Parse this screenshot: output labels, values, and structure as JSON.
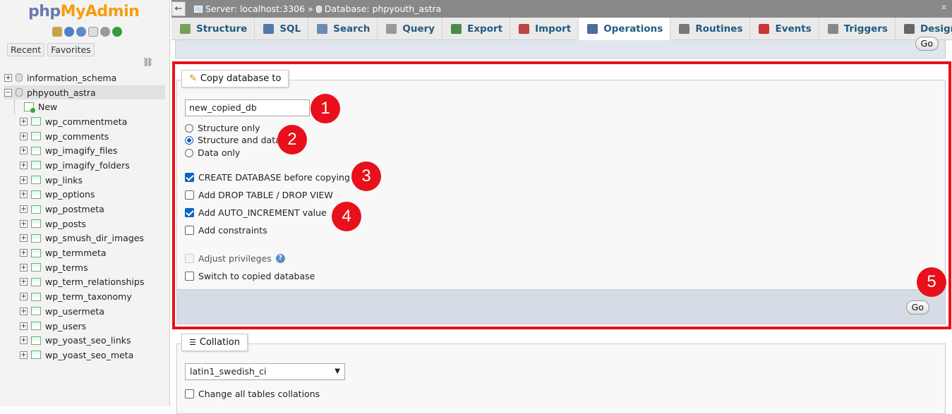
{
  "sidebar": {
    "logo_php": "php",
    "logo_myadmin": "MyAdmin",
    "tabs": [
      "Recent",
      "Favorites"
    ],
    "databases": [
      {
        "name": "information_schema",
        "expanded": false
      },
      {
        "name": "phpyouth_astra",
        "expanded": true
      }
    ],
    "new_label": "New",
    "tables": [
      "wp_commentmeta",
      "wp_comments",
      "wp_imagify_files",
      "wp_imagify_folders",
      "wp_links",
      "wp_options",
      "wp_postmeta",
      "wp_posts",
      "wp_smush_dir_images",
      "wp_termmeta",
      "wp_terms",
      "wp_term_relationships",
      "wp_term_taxonomy",
      "wp_usermeta",
      "wp_users",
      "wp_yoast_seo_links",
      "wp_yoast_seo_meta"
    ]
  },
  "topbar": {
    "back_symbol": "←",
    "server": "Server: localhost:3306",
    "separator": "»",
    "database": "Database: phpyouth_astra",
    "collapse_symbol": "⌅"
  },
  "tabs": [
    {
      "label": "Structure",
      "icon": "structure-icon",
      "active": false
    },
    {
      "label": "SQL",
      "icon": "sql-icon",
      "active": false
    },
    {
      "label": "Search",
      "icon": "search-icon",
      "active": false
    },
    {
      "label": "Query",
      "icon": "query-icon",
      "active": false
    },
    {
      "label": "Export",
      "icon": "export-icon",
      "active": false
    },
    {
      "label": "Import",
      "icon": "import-icon",
      "active": false
    },
    {
      "label": "Operations",
      "icon": "wrench-icon",
      "active": true
    },
    {
      "label": "Routines",
      "icon": "routines-icon",
      "active": false
    },
    {
      "label": "Events",
      "icon": "clock-icon",
      "active": false
    },
    {
      "label": "Triggers",
      "icon": "triggers-icon",
      "active": false
    },
    {
      "label": "Designer",
      "icon": "designer-icon",
      "active": false
    }
  ],
  "prev_panel": {
    "go_label": "Go"
  },
  "copy_db": {
    "legend": "Copy database to",
    "name_value": "new_copied_db",
    "mode_options": [
      {
        "label": "Structure only",
        "checked": false
      },
      {
        "label": "Structure and data",
        "checked": true
      },
      {
        "label": "Data only",
        "checked": false
      }
    ],
    "options": [
      {
        "label": "CREATE DATABASE before copying",
        "checked": true
      },
      {
        "label": "Add DROP TABLE / DROP VIEW",
        "checked": false
      },
      {
        "label": "Add AUTO_INCREMENT value",
        "checked": true
      },
      {
        "label": "Add constraints",
        "checked": false
      }
    ],
    "adjust_privileges": {
      "label": "Adjust privileges",
      "checked": false,
      "disabled": true
    },
    "switch_db": {
      "label": "Switch to copied database",
      "checked": false
    },
    "go_label": "Go"
  },
  "annotations": [
    "1",
    "2",
    "3",
    "4",
    "5"
  ],
  "colors": {
    "highlight": "#e8111a",
    "badge": "#e8101b",
    "tab_text": "#235a81"
  },
  "collation": {
    "legend": "Collation",
    "selected": "latin1_swedish_ci",
    "change_all_label": "Change all tables collations"
  }
}
